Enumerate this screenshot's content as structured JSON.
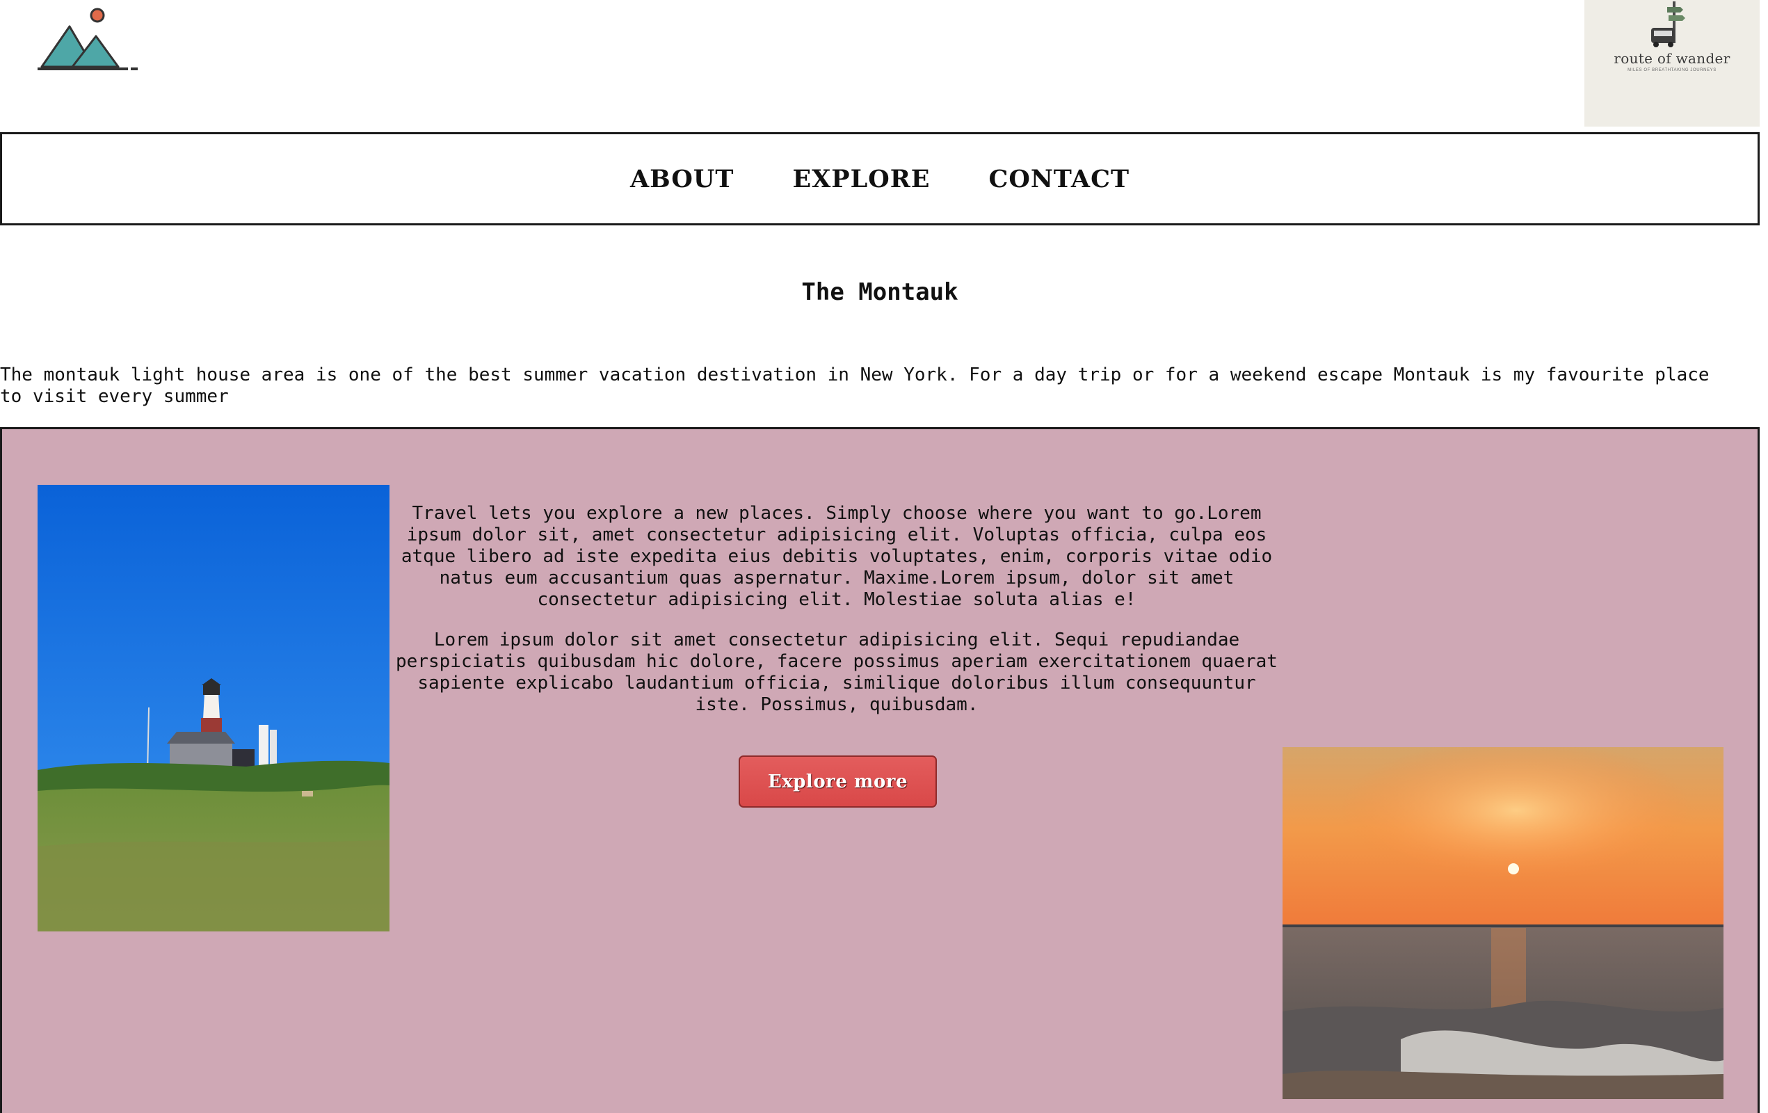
{
  "header": {
    "logo_icon": "mountains-sun-icon",
    "brand": {
      "name": "route of wander",
      "tagline": "MILES OF BREATHTAKING JOURNEYS",
      "icon": "signpost-car-icon"
    }
  },
  "nav": {
    "items": [
      {
        "label": "ABOUT"
      },
      {
        "label": "EXPLORE"
      },
      {
        "label": "CONTACT"
      }
    ]
  },
  "main": {
    "title": "The Montauk",
    "intro": "The montauk light house area is one of the best summer vacation destivation in New York. For a day trip or for a weekend escape Montauk is my favourite place to visit every summer"
  },
  "feature": {
    "paragraph_1": "Travel lets you explore a new places. Simply choose where you want to go.Lorem ipsum dolor sit, amet consectetur adipisicing elit. Voluptas officia, culpa eos atque libero ad iste expedita eius debitis voluptates, enim, corporis vitae odio natus eum accusantium quas aspernatur. Maxime.Lorem ipsum, dolor sit amet consectetur adipisicing elit. Molestiae soluta alias e!",
    "paragraph_2": "Lorem ipsum dolor sit amet consectetur adipisicing elit. Sequi repudiandae perspiciatis quibusdam hic dolore, facere possimus aperiam exercitationem quaerat sapiente explicabo laudantium officia, similique doloribus illum consequuntur iste. Possimus, quibusdam.",
    "button_label": "Explore more",
    "images": [
      "lighthouse-photo",
      "sunset-ocean-photo"
    ]
  },
  "colors": {
    "section_bg": "#cfa8b5",
    "button_bg": "#d94848",
    "logo_teal": "#4ea7a7",
    "logo_sun": "#e06a4a",
    "brand_bg": "#efede6"
  }
}
